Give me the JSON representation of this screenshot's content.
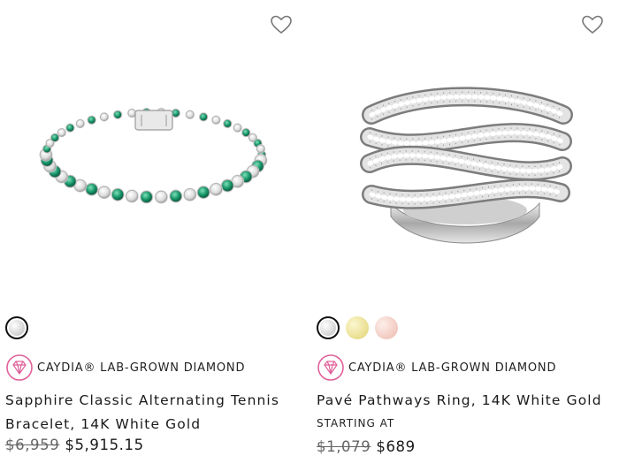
{
  "products": [
    {
      "title": "Sapphire Classic Alternating Tennis Bracelet, 14K White Gold",
      "brand": "CAYDIA® LAB-GROWN DIAMOND",
      "old_price": "$6,959",
      "price": "$5,915.15",
      "swatches": [
        {
          "name": "white-gold",
          "color": "#d9d9d9"
        }
      ]
    },
    {
      "title": "Pavé Pathways Ring, 14K White Gold",
      "brand": "CAYDIA® LAB-GROWN DIAMOND",
      "starting_label": "STARTING AT",
      "old_price": "$1,079",
      "price": "$689",
      "swatches": [
        {
          "name": "white-gold",
          "color": "#dcdcdc"
        },
        {
          "name": "yellow-gold",
          "color": "#ece39a"
        },
        {
          "name": "rose-gold",
          "color": "#f3cfc6"
        }
      ]
    }
  ],
  "colors": {
    "brand_pink": "#e0609a",
    "emerald": "#1a9a6a"
  },
  "icons": {
    "wishlist": "heart-outline-icon",
    "brand": "diamond-badge-icon"
  }
}
